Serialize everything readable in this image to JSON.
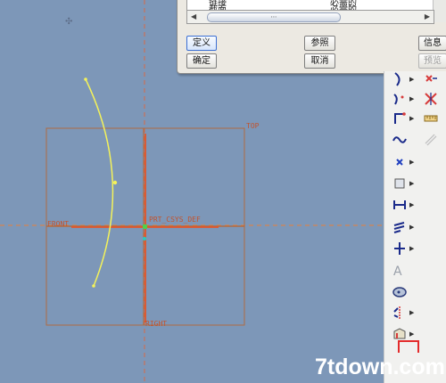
{
  "dialog": {
    "rows": [
      {
        "name": "链接",
        "status": "必需的"
      },
      {
        "name": "截面",
        "status": "必需的"
      }
    ],
    "scroll_thumb": "⋯",
    "buttons": {
      "define": "定义",
      "confirm": "确定",
      "reference": "参照",
      "cancel": "取消",
      "info": "信息",
      "preview": "预览"
    }
  },
  "datum_labels": {
    "top": "TOP",
    "front": "FRONT",
    "right": "RIGHT",
    "csys": "PRT_CSYS_DEF"
  },
  "toolbar": {
    "icons": [
      "sketch-curve-icon",
      "trim-curve-icon",
      "line-tool-icon",
      "fillet-icon",
      "spline-icon",
      "chain-link-icon",
      "point-icon",
      "rectangle-icon",
      "dimension-icon",
      "constraint-icon",
      "centerline-icon",
      "text-icon",
      "palette-icon",
      "mirror-icon",
      "sketch-view-icon"
    ]
  },
  "watermark": "7tdown.com",
  "colors": {
    "canvas_bg": "#7d97b8",
    "datum": "#b06b42",
    "sketch_curve": "#f4f25a",
    "axis_red": "#e0552c",
    "dashed_orange": "#e87f3a",
    "highlight_red": "#e32b2b"
  }
}
